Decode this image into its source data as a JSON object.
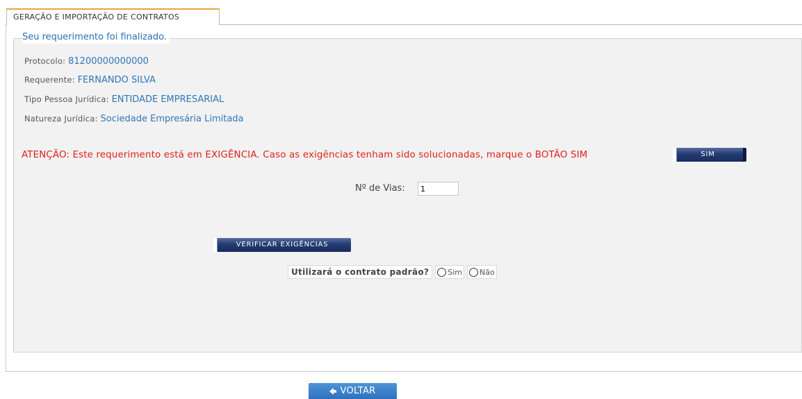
{
  "tab": {
    "label": "GERAÇÃO E IMPORTAÇÃO DE CONTRATOS"
  },
  "form": {
    "legend": "Seu requerimento foi finalizado.",
    "protocolo": {
      "label": "Protocolo:",
      "value": "81200000000000"
    },
    "requerente": {
      "label": "Requerente:",
      "value": "FERNANDO SILVA"
    },
    "tipo_pessoa": {
      "label": "Tipo Pessoa Jurídica:",
      "value": "ENTIDADE EMPRESARIAL"
    },
    "natureza": {
      "label": "Natureza Jurídica:",
      "value": "Sociedade Empresária Limitada"
    },
    "warning": "ATENÇÃO: Este requerimento está em EXIGÊNCIA. Caso as exigências tenham sido solucionadas, marque o BOTÃO SIM",
    "sim_button": "SIM",
    "vias": {
      "label": "Nº de Vias:",
      "value": "1"
    },
    "verificar_button": "VERIFICAR EXIGÊNCIAS",
    "contrato": {
      "question": "Utilizará o contrato padrão?",
      "options": [
        "Sim",
        "Não"
      ]
    }
  },
  "voltar_button": "VOLTAR",
  "colors": {
    "accent_tab": "#e8a33c",
    "value_blue": "#2f76b8",
    "warning_red": "#e0201a",
    "navy_button": "#243b74",
    "voltar_blue": "#2d72bf"
  },
  "icons": {
    "voltar": "arrow-left-icon"
  }
}
